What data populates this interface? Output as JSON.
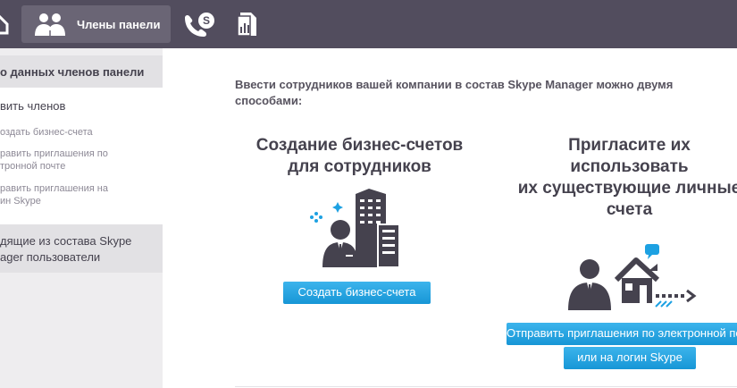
{
  "topbar": {
    "active_label": "Члены панели",
    "icons": [
      "home-icon",
      "members-icon",
      "skype-call-icon",
      "documents-icon"
    ]
  },
  "sidebar": {
    "section1_title": "о данных членов панели",
    "main_item": "вить членов",
    "links": [
      {
        "line1": "оздать бизнес-счета",
        "line2": ""
      },
      {
        "line1": "равить приглашения по",
        "line2": "тронной почте"
      },
      {
        "line1": "равить приглашения на",
        "line2": "ин Skype"
      }
    ],
    "section2_line1": "дящие из состава Skype",
    "section2_line2": "ager пользователи"
  },
  "main": {
    "intro": "Ввести сотрудников вашей компании в состав Skype Manager можно двумя способами:",
    "col1": {
      "title_line1": "Создание бизнес-счетов",
      "title_line2": "для сотрудников",
      "button": "Создать бизнес-счета"
    },
    "col2": {
      "title_line1": "Пригласите их",
      "title_line2": "использовать",
      "title_line3": "их существующие личные",
      "title_line4": "счета",
      "button_line1": "Отправить приглашения по электронной почте",
      "button_line2": "или на логин Skype"
    }
  },
  "colors": {
    "topbar": "#524d5e",
    "accent_button": "#1796d6",
    "sidebar_bg": "#eeedef",
    "text": "#45424e"
  }
}
